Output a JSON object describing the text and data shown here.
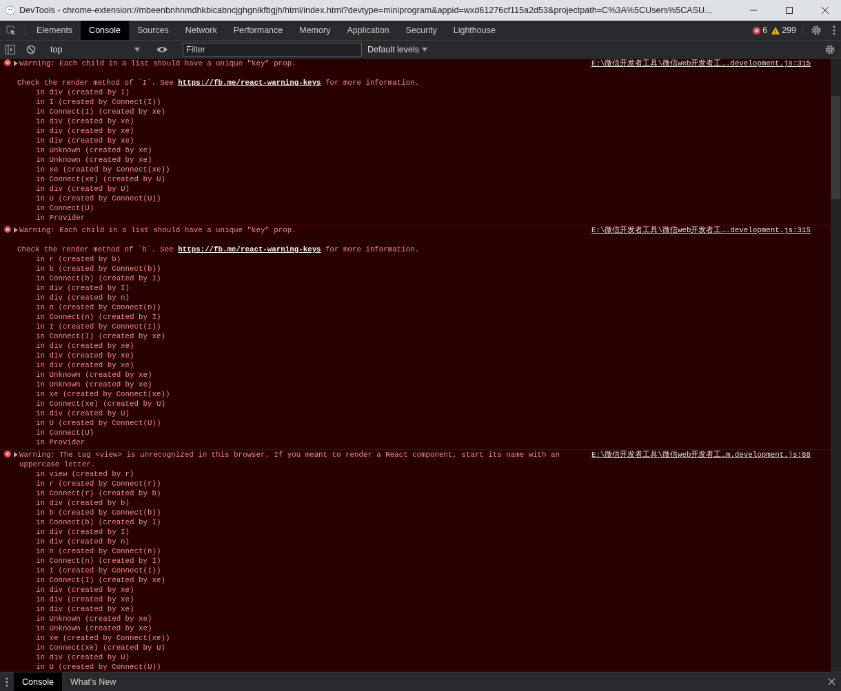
{
  "window": {
    "title": "DevTools - chrome-extension://mbeenbnhnmdhkbicabncjghgnikfbgjh/html/index.html?devtype=miniprogram&appid=wxd61276cf115a2d53&projectpath=C%3A%5CUsers%5CASU..."
  },
  "tabs": [
    {
      "label": "Elements",
      "selected": false
    },
    {
      "label": "Console",
      "selected": true
    },
    {
      "label": "Sources",
      "selected": false
    },
    {
      "label": "Network",
      "selected": false
    },
    {
      "label": "Performance",
      "selected": false
    },
    {
      "label": "Memory",
      "selected": false
    },
    {
      "label": "Application",
      "selected": false
    },
    {
      "label": "Security",
      "selected": false
    },
    {
      "label": "Lighthouse",
      "selected": false
    }
  ],
  "counts": {
    "errors": "6",
    "warnings": "299"
  },
  "toolbar": {
    "context": "top",
    "filter": {
      "placeholder": "Filter"
    },
    "levels": "Default levels"
  },
  "messages": [
    {
      "kind": "error",
      "text": "Warning: Each child in a list should have a unique \"key\" prop.",
      "source": "E:\\微信开发者工具\\微信web开发者工….development.js:315",
      "detail": {
        "before": "Check the render method of `I`. See ",
        "link": "https://fb.me/react-warning-keys",
        "after": " for more information."
      },
      "stack": [
        "in div (created by I)",
        "in I (created by Connect(I))",
        "in Connect(I) (created by xe)",
        "in div (created by xe)",
        "in div (created by xe)",
        "in div (created by xe)",
        "in Unknown (created by xe)",
        "in Unknown (created by xe)",
        "in xe (created by Connect(xe))",
        "in Connect(xe) (created by U)",
        "in div (created by U)",
        "in U (created by Connect(U))",
        "in Connect(U)",
        "in Provider"
      ]
    },
    {
      "kind": "error",
      "text": "Warning: Each child in a list should have a unique \"key\" prop.",
      "source": "E:\\微信开发者工具\\微信web开发者工….development.js:315",
      "detail": {
        "before": "Check the render method of `b`. See ",
        "link": "https://fb.me/react-warning-keys",
        "after": " for more information."
      },
      "stack": [
        "in r (created by b)",
        "in b (created by Connect(b))",
        "in Connect(b) (created by I)",
        "in div (created by I)",
        "in div (created by n)",
        "in n (created by Connect(n))",
        "in Connect(n) (created by I)",
        "in I (created by Connect(I))",
        "in Connect(I) (created by xe)",
        "in div (created by xe)",
        "in div (created by xe)",
        "in div (created by xe)",
        "in Unknown (created by xe)",
        "in Unknown (created by xe)",
        "in xe (created by Connect(xe))",
        "in Connect(xe) (created by U)",
        "in div (created by U)",
        "in U (created by Connect(U))",
        "in Connect(U)",
        "in Provider"
      ]
    },
    {
      "kind": "error",
      "text": "Warning: The tag <view> is unrecognized in this browser. If you meant to render a React component, start its name with an uppercase letter.",
      "source": "E:\\微信开发者工具\\微信web开发者工…m.development.js:88",
      "stack": [
        "in view (created by r)",
        "in r (created by Connect(r))",
        "in Connect(r) (created by b)",
        "in div (created by b)",
        "in b (created by Connect(b))",
        "in Connect(b) (created by I)",
        "in div (created by I)",
        "in div (created by n)",
        "in n (created by Connect(n))",
        "in Connect(n) (created by I)",
        "in I (created by Connect(I))",
        "in Connect(I) (created by xe)",
        "in div (created by xe)",
        "in div (created by xe)",
        "in div (created by xe)",
        "in Unknown (created by xe)",
        "in Unknown (created by xe)",
        "in xe (created by Connect(xe))",
        "in Connect(xe) (created by U)",
        "in div (created by U)",
        "in U (created by Connect(U))"
      ]
    }
  ],
  "drawer": {
    "tabs": [
      {
        "label": "Console",
        "selected": true
      },
      {
        "label": "What's New",
        "selected": false
      }
    ]
  }
}
